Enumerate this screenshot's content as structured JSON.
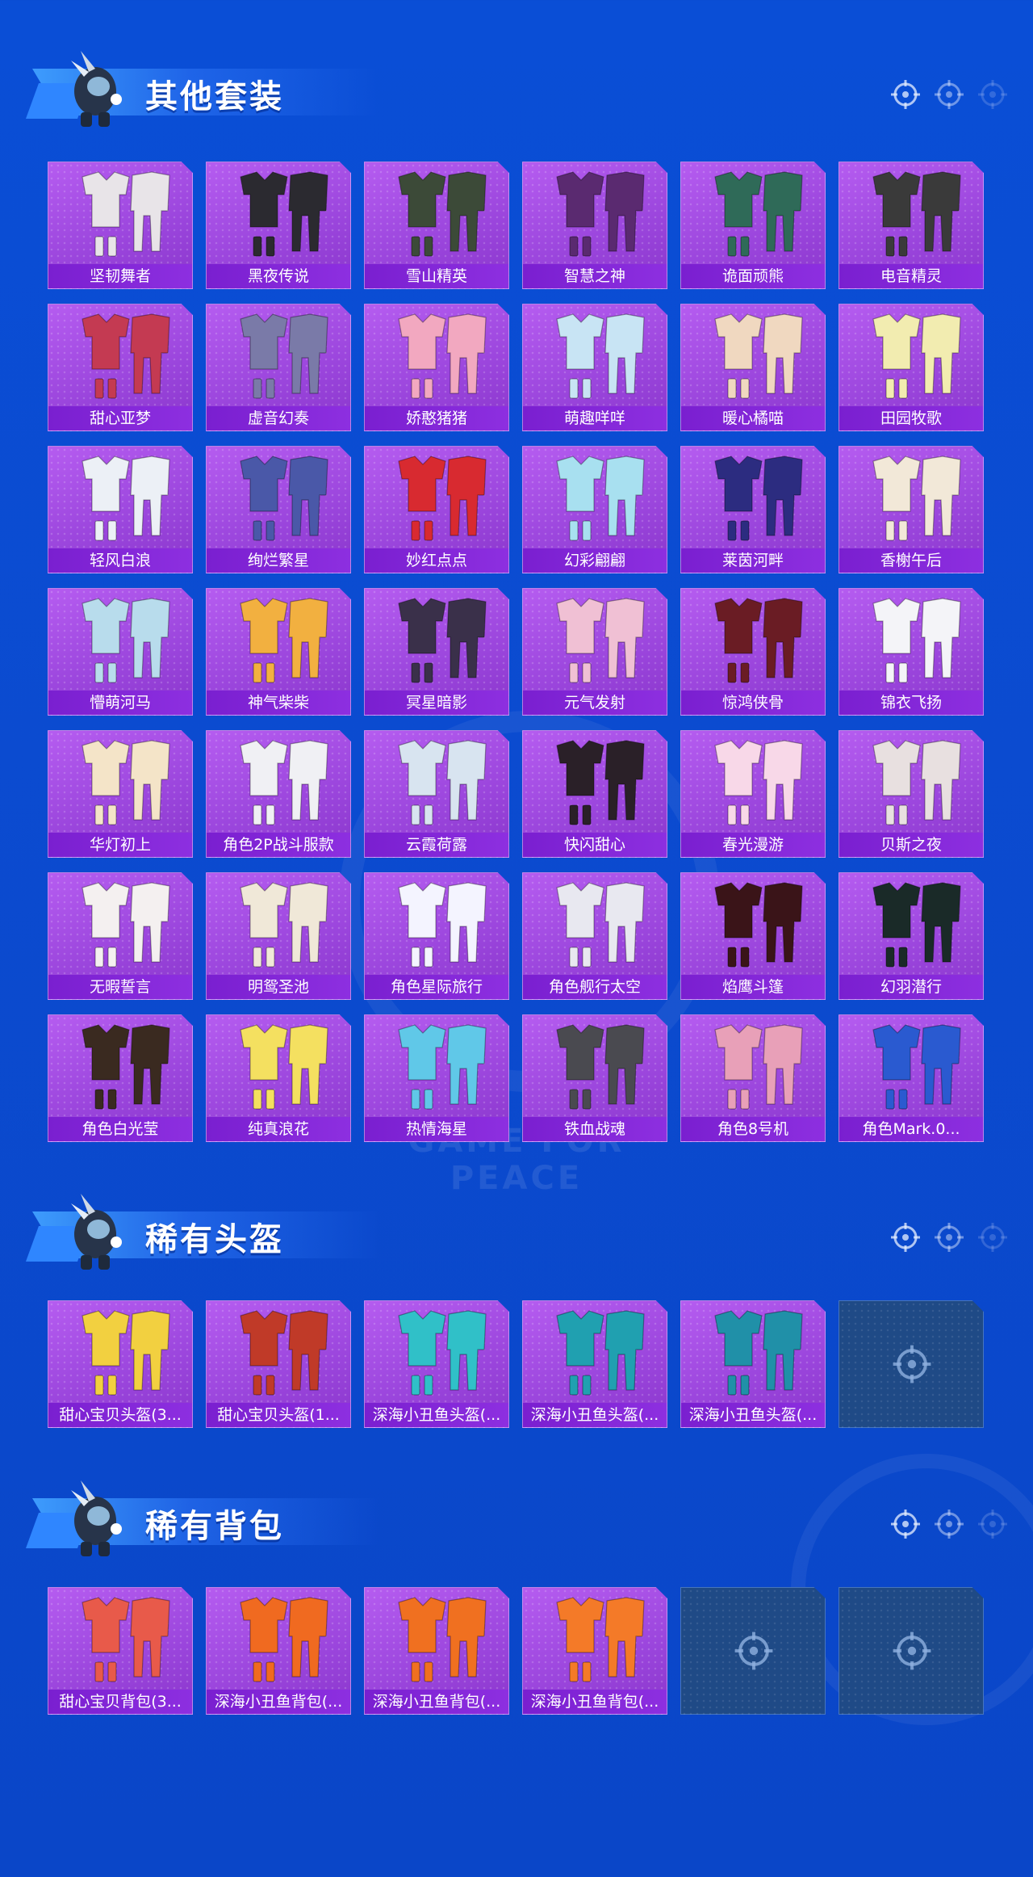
{
  "sections": [
    {
      "title": "其他套装",
      "items": [
        {
          "label": "坚韧舞者",
          "color": "#e8e4e8"
        },
        {
          "label": "黑夜传说",
          "color": "#2b2a30"
        },
        {
          "label": "雪山精英",
          "color": "#3c4a38"
        },
        {
          "label": "智慧之神",
          "color": "#5a2a70"
        },
        {
          "label": "诡面顽熊",
          "color": "#2f6a58"
        },
        {
          "label": "电音精灵",
          "color": "#3a3a3a"
        },
        {
          "label": "甜心亚梦",
          "color": "#c43a52"
        },
        {
          "label": "虚音幻奏",
          "color": "#7a7aa8"
        },
        {
          "label": "娇憨猪猪",
          "color": "#f2a8c0"
        },
        {
          "label": "萌趣咩咩",
          "color": "#c8e4f4"
        },
        {
          "label": "暖心橘喵",
          "color": "#f0d8c0"
        },
        {
          "label": "田园牧歌",
          "color": "#f2ecb0"
        },
        {
          "label": "轻风白浪",
          "color": "#ecf0f6"
        },
        {
          "label": "绚烂繁星",
          "color": "#4a58a8"
        },
        {
          "label": "妙红点点",
          "color": "#d82a30"
        },
        {
          "label": "幻彩翩翩",
          "color": "#a8e0f0"
        },
        {
          "label": "莱茵河畔",
          "color": "#2c2c80"
        },
        {
          "label": "香榭午后",
          "color": "#f2e8d8"
        },
        {
          "label": "懵萌河马",
          "color": "#b8dcec"
        },
        {
          "label": "神气柴柴",
          "color": "#f2b040"
        },
        {
          "label": "冥星暗影",
          "color": "#3a304a"
        },
        {
          "label": "元气发射",
          "color": "#f0c0d4"
        },
        {
          "label": "惊鸿侠骨",
          "color": "#6a1c24"
        },
        {
          "label": "锦衣飞扬",
          "color": "#f4f4f8"
        },
        {
          "label": "华灯初上",
          "color": "#f4e4c8"
        },
        {
          "label": "角色2P战斗服款",
          "color": "#f0f0f4"
        },
        {
          "label": "云霞荷露",
          "color": "#d8e4f0"
        },
        {
          "label": "快闪甜心",
          "color": "#2a2028"
        },
        {
          "label": "春光漫游",
          "color": "#f8d8e8"
        },
        {
          "label": "贝斯之夜",
          "color": "#e8e0e0"
        },
        {
          "label": "无暇誓言",
          "color": "#f4f0f0"
        },
        {
          "label": "明鸳圣池",
          "color": "#f0e8d8"
        },
        {
          "label": "角色星际旅行",
          "color": "#f4f4ff"
        },
        {
          "label": "角色舰行太空",
          "color": "#e8e8f0"
        },
        {
          "label": "焰鹰斗篷",
          "color": "#3a1418"
        },
        {
          "label": "幻羽潜行",
          "color": "#1a2a28"
        },
        {
          "label": "角色白光莹",
          "color": "#3a2a20"
        },
        {
          "label": "纯真浪花",
          "color": "#f4e060"
        },
        {
          "label": "热情海星",
          "color": "#60c8e8"
        },
        {
          "label": "铁血战魂",
          "color": "#4a4a50"
        },
        {
          "label": "角色8号机",
          "color": "#e8a0b8"
        },
        {
          "label": "角色Mark.0...",
          "color": "#2a5ad0"
        }
      ]
    },
    {
      "title": "稀有头盔",
      "items": [
        {
          "label": "甜心宝贝头盔(3...",
          "color": "#f2d040"
        },
        {
          "label": "甜心宝贝头盔(1...",
          "color": "#c03a28"
        },
        {
          "label": "深海小丑鱼头盔(...",
          "color": "#30c0c8"
        },
        {
          "label": "深海小丑鱼头盔(...",
          "color": "#20a0b0"
        },
        {
          "label": "深海小丑鱼头盔(...",
          "color": "#2090a8"
        },
        {
          "empty": true
        }
      ]
    },
    {
      "title": "稀有背包",
      "items": [
        {
          "label": "甜心宝贝背包(3...",
          "color": "#e85a4a"
        },
        {
          "label": "深海小丑鱼背包(...",
          "color": "#f06a20"
        },
        {
          "label": "深海小丑鱼背包(...",
          "color": "#f07020"
        },
        {
          "label": "深海小丑鱼背包(...",
          "color": "#f47a28"
        },
        {
          "empty": true
        },
        {
          "empty": true
        }
      ]
    }
  ],
  "watermark": "GAME FOR PEACE",
  "colors": {
    "background": "#0a4ed6",
    "card": "#a24be0",
    "card_label": "#7a1fd0",
    "empty_card": "#1f4a86"
  }
}
